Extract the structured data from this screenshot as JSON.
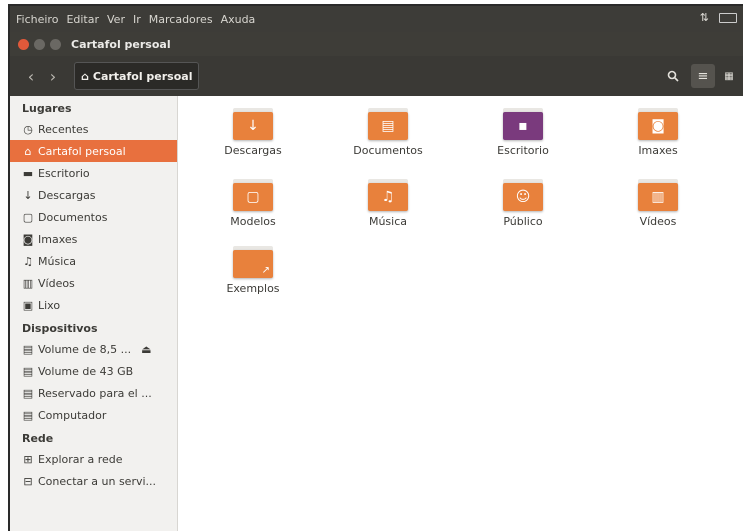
{
  "menubar": {
    "items": [
      "Ficheiro",
      "Editar",
      "Ver",
      "Ir",
      "Marcadores",
      "Axuda"
    ]
  },
  "window": {
    "title": "Cartafol persoal"
  },
  "toolbar": {
    "back": "‹",
    "forward": "›",
    "path_label": "Cartafol persoal"
  },
  "sidebar": {
    "places_header": "Lugares",
    "places": [
      {
        "label": "Recentes",
        "icon": "clock-icon"
      },
      {
        "label": "Cartafol persoal",
        "icon": "home-icon",
        "selected": true
      },
      {
        "label": "Escritorio",
        "icon": "desktop-icon"
      },
      {
        "label": "Descargas",
        "icon": "download-icon"
      },
      {
        "label": "Documentos",
        "icon": "document-icon"
      },
      {
        "label": "Imaxes",
        "icon": "camera-icon"
      },
      {
        "label": "Música",
        "icon": "music-icon"
      },
      {
        "label": "Vídeos",
        "icon": "film-icon"
      },
      {
        "label": "Lixo",
        "icon": "trash-icon"
      }
    ],
    "devices_header": "Dispositivos",
    "devices": [
      {
        "label": "Volume de 8,5 ...",
        "icon": "drive-icon"
      },
      {
        "label": "Volume de 43 GB",
        "icon": "drive-icon"
      },
      {
        "label": "Reservado para el ...",
        "icon": "drive-icon"
      },
      {
        "label": "Computador",
        "icon": "drive-icon"
      }
    ],
    "network_header": "Rede",
    "network": [
      {
        "label": "Explorar a rede",
        "icon": "network-icon"
      },
      {
        "label": "Conectar a un servi...",
        "icon": "server-icon"
      }
    ]
  },
  "folders": [
    {
      "label": "Descargas",
      "icon": "download-icon"
    },
    {
      "label": "Documentos",
      "icon": "document-icon"
    },
    {
      "label": "Escritorio",
      "icon": "desktop-icon"
    },
    {
      "label": "Imaxes",
      "icon": "camera-icon"
    },
    {
      "label": "Modelos",
      "icon": "template-icon"
    },
    {
      "label": "Música",
      "icon": "music-icon"
    },
    {
      "label": "Público",
      "icon": "person-icon"
    },
    {
      "label": "Vídeos",
      "icon": "film-icon"
    },
    {
      "label": "Exemplos",
      "icon": "link-icon"
    }
  ],
  "colors": {
    "accent": "#e8703e",
    "folder": "#e8813c",
    "desktop_folder": "#7a3a7d",
    "chrome": "#3d3c38"
  }
}
